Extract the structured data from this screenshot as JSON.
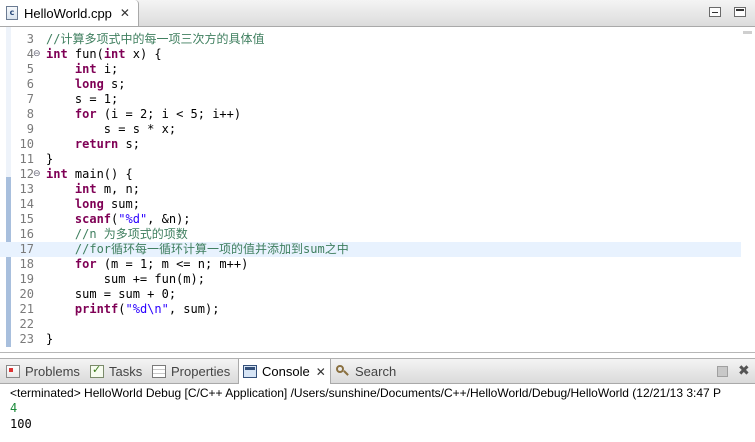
{
  "editor": {
    "tab_label": "HelloWorld.cpp",
    "file_icon_text": "c",
    "current_line": "17",
    "lines": [
      {
        "num": "3",
        "fold": "",
        "text": "//计算多项式中的每一项三次方的具体值"
      },
      {
        "num": "4",
        "fold": "⊖",
        "text": "int fun(int x) {"
      },
      {
        "num": "5",
        "fold": "",
        "text": "    int i;"
      },
      {
        "num": "6",
        "fold": "",
        "text": "    long s;"
      },
      {
        "num": "7",
        "fold": "",
        "text": "    s = 1;"
      },
      {
        "num": "8",
        "fold": "",
        "text": "    for (i = 2; i < 5; i++)"
      },
      {
        "num": "9",
        "fold": "",
        "text": "        s = s * x;"
      },
      {
        "num": "10",
        "fold": "",
        "text": "    return s;"
      },
      {
        "num": "11",
        "fold": "",
        "text": "}"
      },
      {
        "num": "12",
        "fold": "⊖",
        "text": "int main() {"
      },
      {
        "num": "13",
        "fold": "",
        "text": "    int m, n;"
      },
      {
        "num": "14",
        "fold": "",
        "text": "    long sum;"
      },
      {
        "num": "15",
        "fold": "",
        "text": "    scanf(\"%d\", &n);"
      },
      {
        "num": "16",
        "fold": "",
        "text": "    //n 为多项式的项数"
      },
      {
        "num": "17",
        "fold": "",
        "text": "    //for循环每一循环计算一项的值并添加到sum之中"
      },
      {
        "num": "18",
        "fold": "",
        "text": "    for (m = 1; m <= n; m++)"
      },
      {
        "num": "19",
        "fold": "",
        "text": "        sum += fun(m);"
      },
      {
        "num": "20",
        "fold": "",
        "text": "    sum = sum + 0;"
      },
      {
        "num": "21",
        "fold": "",
        "text": "    printf(\"%d\\n\", sum);"
      },
      {
        "num": "22",
        "fold": "",
        "text": ""
      },
      {
        "num": "23",
        "fold": "",
        "text": "}"
      }
    ]
  },
  "console": {
    "tabs": [
      {
        "label": "Problems",
        "icon": "problems-icon",
        "active": false
      },
      {
        "label": "Tasks",
        "icon": "tasks-icon",
        "active": false
      },
      {
        "label": "Properties",
        "icon": "properties-icon",
        "active": false
      },
      {
        "label": "Console",
        "icon": "console-icon",
        "active": true
      },
      {
        "label": "Search",
        "icon": "search-icon",
        "active": false
      }
    ],
    "header": "<terminated> HelloWorld Debug [C/C++ Application] /Users/sunshine/Documents/C++/HelloWorld/Debug/HelloWorld (12/21/13 3:47 P",
    "input_echo": "4",
    "output": "100",
    "input_color": "#1a8a3a"
  },
  "colors": {
    "keyword": "#7f0055",
    "string": "#2a00ff",
    "comment": "#3f7f5f",
    "current_line_bg": "#e8f2fe"
  }
}
